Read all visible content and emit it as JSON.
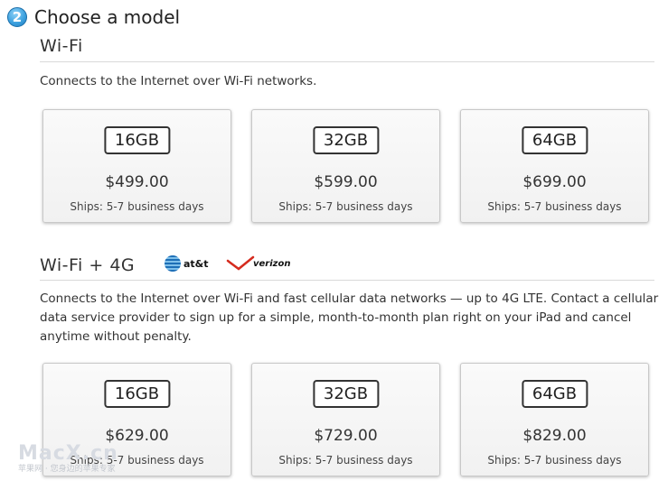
{
  "step": {
    "number": "2",
    "title": "Choose a model"
  },
  "wifi": {
    "title": "Wi-Fi",
    "description": "Connects to the Internet over Wi-Fi networks.",
    "cards": [
      {
        "capacity": "16GB",
        "price": "$499.00",
        "ships": "Ships: 5-7 business days"
      },
      {
        "capacity": "32GB",
        "price": "$599.00",
        "ships": "Ships: 5-7 business days"
      },
      {
        "capacity": "64GB",
        "price": "$699.00",
        "ships": "Ships: 5-7 business days"
      }
    ]
  },
  "wifi4g": {
    "title": "Wi-Fi + 4G",
    "carriers": {
      "att": "at&t",
      "verizon": "verizon"
    },
    "description": "Connects to the Internet over Wi-Fi and fast cellular data networks — up to 4G LTE. Contact a cellular data service provider to sign up for a simple, month-to-month plan right on your iPad and cancel anytime without penalty.",
    "cards": [
      {
        "capacity": "16GB",
        "price": "$629.00",
        "ships": "Ships: 5-7 business days"
      },
      {
        "capacity": "32GB",
        "price": "$729.00",
        "ships": "Ships: 5-7 business days"
      },
      {
        "capacity": "64GB",
        "price": "$829.00",
        "ships": "Ships: 5-7 business days"
      }
    ]
  },
  "watermark": {
    "main": "MacX.cn",
    "sub": "苹果网 · 您身边的苹果专家"
  }
}
